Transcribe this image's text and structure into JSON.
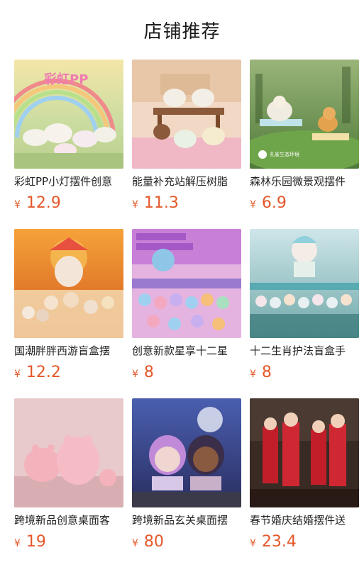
{
  "header": {
    "title": "店铺推荐"
  },
  "products": [
    {
      "name": "彩虹PP小灯摆件创意",
      "currency": "¥",
      "price": "12.9",
      "image": "rainbow-pig-lamp"
    },
    {
      "name": "能量补充站解压树脂",
      "currency": "¥",
      "price": "11.3",
      "image": "bubble-tea-cats"
    },
    {
      "name": "森林乐园微景观摆件",
      "currency": "¥",
      "price": "6.9",
      "image": "forest-sheep-fox",
      "badge": "孔雀生态环境"
    },
    {
      "name": "国潮胖胖西游盲盒摆",
      "currency": "¥",
      "price": "12.2",
      "image": "journey-west-blindbox"
    },
    {
      "name": "创意新款星享十二星",
      "currency": "¥",
      "price": "8",
      "image": "zodiac-girls"
    },
    {
      "name": "十二生肖护法盲盒手",
      "currency": "¥",
      "price": "8",
      "image": "zodiac-guardians"
    },
    {
      "name": "跨境新品创意桌面客",
      "currency": "¥",
      "price": "19",
      "image": "pink-pigs"
    },
    {
      "name": "跨境新品玄关桌面摆",
      "currency": "¥",
      "price": "80",
      "image": "praying-angels"
    },
    {
      "name": "春节婚庆结婚摆件送",
      "currency": "¥",
      "price": "23.4",
      "image": "wedding-couple"
    }
  ]
}
